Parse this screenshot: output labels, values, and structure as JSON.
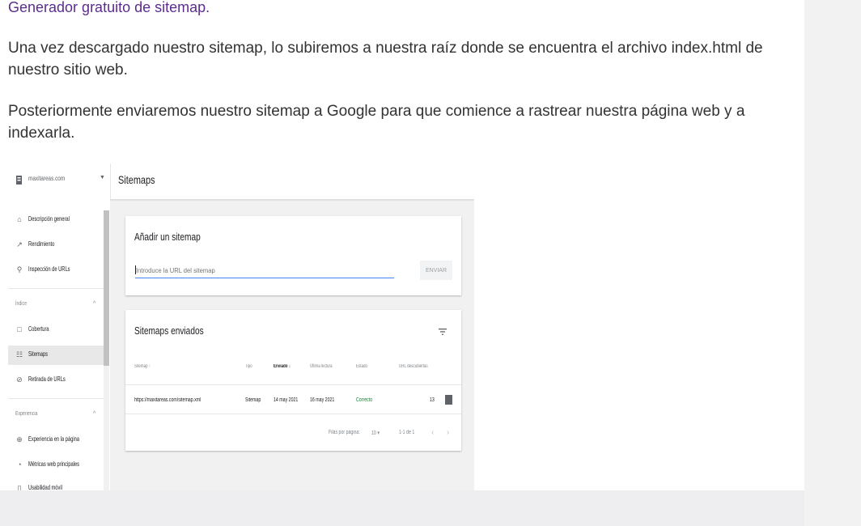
{
  "article": {
    "link_text": "Generador gratuito de sitemap.",
    "paragraph_1": "Una vez descargado nuestro sitemap, lo subiremos a nuestra raíz donde se encuentra el archivo index.html de nuestro sitio web.",
    "paragraph_2": "Posteriormente enviaremos nuestro sitemap a Google para que comience a rastrear nuestra página web y a indexarla."
  },
  "screenshot": {
    "property": "maxitareas.com",
    "page_title": "Sitemaps",
    "sidebar": {
      "items_top": [
        {
          "label": "Descripción general",
          "icon": "home-icon"
        },
        {
          "label": "Rendimiento",
          "icon": "trend-icon"
        },
        {
          "label": "Inspección de URLs",
          "icon": "search-icon"
        }
      ],
      "section_index": "Índice",
      "items_index": [
        {
          "label": "Cobertura",
          "icon": "file-icon"
        },
        {
          "label": "Sitemaps",
          "icon": "sitemap-icon",
          "active": true
        },
        {
          "label": "Retirada de URLs",
          "icon": "remove-icon"
        }
      ],
      "section_experience": "Experiencia",
      "items_experience": [
        {
          "label": "Experiencia en la página",
          "icon": "plus-circle-icon"
        },
        {
          "label": "Métricas web principales",
          "icon": "gauge-icon"
        },
        {
          "label": "Usabilidad móvil",
          "icon": "phone-icon"
        }
      ]
    },
    "add_card": {
      "title": "Añadir un sitemap",
      "input_placeholder": "Introduce la URL del sitemap",
      "submit_label": "ENVIAR"
    },
    "sent_card": {
      "title": "Sitemaps enviados",
      "columns": [
        "Sitemap",
        "Tipo",
        "Enviado",
        "Última lectura",
        "Estado",
        "URL descubiertas"
      ],
      "sort_arrow_sitemap": "↑",
      "sort_arrow_sent": "↓",
      "rows": [
        {
          "sitemap": "https://maxitareas.com/sitemap.xml",
          "type": "Sitemap",
          "sent": "14 may 2021",
          "last_read": "16 may 2021",
          "status": "Correcto",
          "discovered": "13"
        }
      ],
      "pagination": {
        "rows_per_page_label": "Filas por página:",
        "rows_per_page": "10",
        "range": "1-1 de 1",
        "prev": "‹",
        "next": "›"
      }
    },
    "colors": {
      "status_ok": "#188038",
      "input_underline": "#4285f4",
      "link_purple": "#5b2d8e"
    }
  }
}
